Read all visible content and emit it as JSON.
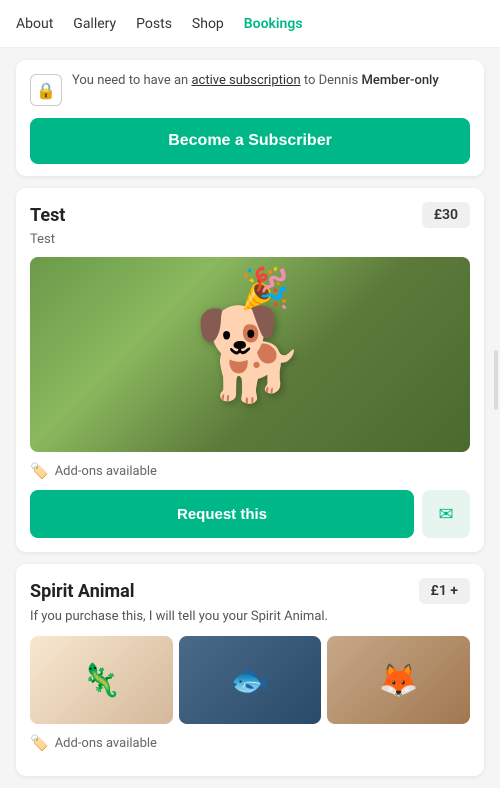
{
  "nav": {
    "items": [
      {
        "label": "About",
        "active": false
      },
      {
        "label": "Gallery",
        "active": false
      },
      {
        "label": "Posts",
        "active": false
      },
      {
        "label": "Shop",
        "active": false
      },
      {
        "label": "Bookings",
        "active": true
      }
    ]
  },
  "subscription_banner": {
    "notice_prefix": "You need to have an ",
    "notice_link": "active subscription",
    "notice_mid": " to Dennis ",
    "notice_suffix": "Member-only",
    "button_label": "Become a Subscriber"
  },
  "test_card": {
    "title": "Test",
    "subtitle": "Test",
    "price": "£30",
    "addons_label": "Add-ons available",
    "request_label": "Request this",
    "image_emoji": "🐕"
  },
  "spirit_animal_card": {
    "title": "Spirit Animal",
    "price": "£1 +",
    "description": "If you purchase this, I will tell you your Spirit Animal.",
    "addons_label": "Add-ons available",
    "images": [
      {
        "emoji": "🦎",
        "bg": "axolotl"
      },
      {
        "emoji": "🐟",
        "bg": "fish"
      },
      {
        "emoji": "🦊",
        "bg": "fox"
      }
    ]
  },
  "icons": {
    "lock": "🔒",
    "addons": "🏷",
    "email": "✉"
  }
}
